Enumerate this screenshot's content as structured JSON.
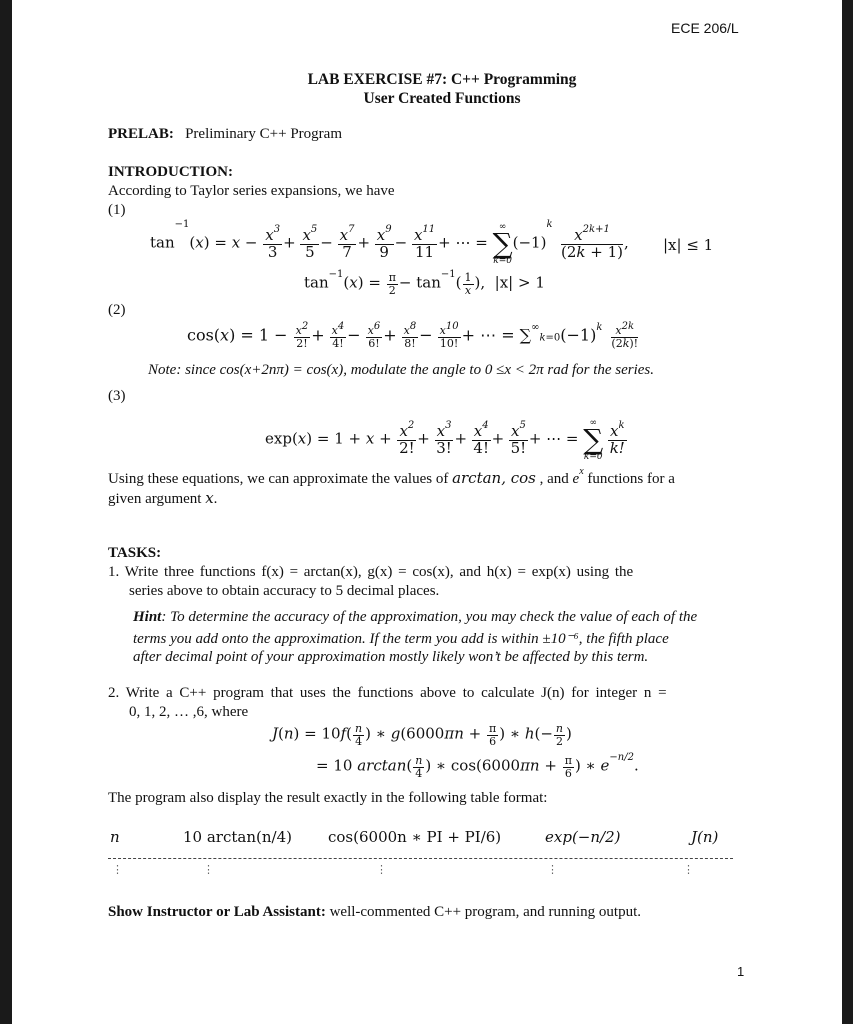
{
  "header": {
    "course": "ECE 206/L",
    "title_line1": "LAB EXERCISE #7:  C++ Programming",
    "title_line2": "User Created Functions",
    "page_number": "1"
  },
  "prelab": {
    "label": "PRELAB:",
    "text": "Preliminary C++ Program"
  },
  "introduction": {
    "heading": "INTRODUCTION:",
    "lead": "According to Taylor series expansions, we have",
    "eq1_label": "(1)",
    "eq1_line1": "tan⁻¹(x) = x − x³/3 + x⁵/5 − x⁷/7 + x⁹/9 − x¹¹/11 + ⋯ = Σ_{k=0}^{∞} (−1)^k x^{2k+1}/(2k+1),   |x| ≤ 1",
    "eq1_line2": "tan⁻¹(x) = π/2 − tan⁻¹(1/x),  |x| > 1",
    "eq1_condition1": "|x| ≤ 1",
    "eq1_condition2": "|x| > 1",
    "eq2_label": "(2)",
    "eq2": "cos(x) = 1 − x²/2! + x⁴/4! − x⁶/6! + x⁸/8! − x¹⁰/10! + ⋯ = Σ_{k=0}^{∞} (−1)^k x^{2k}/(2k)!",
    "note": "Note:  since cos(x+2nπ) = cos(x), modulate the angle to 0 ≤x < 2π rad for the series.",
    "eq3_label": "(3)",
    "eq3": "exp(x) = 1 + x + x²/2! + x³/3! + x⁴/4! + x⁵/5! + ⋯ = Σ_{k=0}^{∞} x^k/k!",
    "summary_a": "Using these equations, we can approximate the values of ",
    "summary_funcs": "arctan, cos",
    "summary_b": " , and ",
    "summary_e": "e",
    "summary_ex": "x",
    "summary_c": " functions for a",
    "summary_line2a": "given argument ",
    "summary_line2x": "x",
    "summary_line2b": "."
  },
  "tasks": {
    "heading": "TASKS:",
    "task1_line1": "1. Write three functions f(x) = arctan(x), g(x) = cos(x), and h(x) = exp(x) using the",
    "task1_line2": "series above to obtain accuracy to 5 decimal places.",
    "hint_label": "Hint",
    "hint_line1": ": To determine the accuracy of the approximation, you may check the value of each of the",
    "hint_line2": "terms you add onto the approximation. If the term you add is within ±10⁻⁶, the fifth place",
    "hint_line3": "after decimal point of your approximation mostly likely won’t be affected by this term.",
    "task2_line1": "2. Write a C++ program that uses the functions above to calculate J(n) for integer n =",
    "task2_line2": "0, 1, 2, … ,6, where",
    "j_eq1": "J(n) = 10f(n/4) ∗ g(6000πn + π/6) ∗ h(−n/2)",
    "j_eq2": "= 10 arctan(n/4) ∗ cos(6000πn + π/6) ∗ e^(−n/2).",
    "table_intro": "The program also display the result exactly in the following table format:"
  },
  "table": {
    "headers": [
      "n",
      "10 arctan(n/4)",
      "cos(6000n ∗ PI + PI/6)",
      "exp(−n/2)",
      "J(n)"
    ],
    "ellipsis": "⋮"
  },
  "footer": {
    "label": "Show Instructor or Lab Assistant:",
    "text": " well-commented C++ program, and running output."
  }
}
